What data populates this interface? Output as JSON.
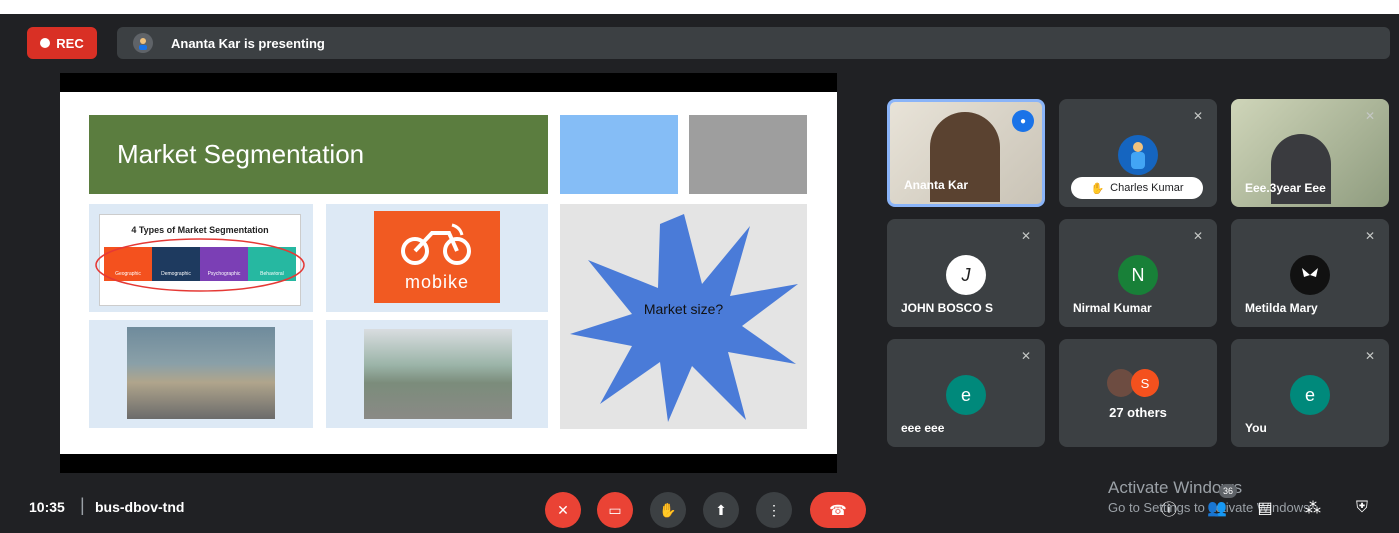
{
  "recording": {
    "label": "REC"
  },
  "presenter_bar": {
    "text": "Ananta Kar is presenting"
  },
  "slide": {
    "title": "Market Segmentation",
    "types_card": {
      "title": "4 Types of Market Segmentation",
      "segments": [
        "Geographic",
        "Demographic",
        "Psychographic",
        "Behavioral"
      ]
    },
    "logo_text": "mobike",
    "starburst_text": "Market size?"
  },
  "participants": [
    {
      "name": "Ananta Kar",
      "initial": "",
      "muted": false,
      "speaking": true,
      "hand_raised": false
    },
    {
      "name": "Charles Kumar",
      "initial": "",
      "muted": true,
      "speaking": false,
      "hand_raised": true
    },
    {
      "name": "Eee.3year Eee",
      "initial": "",
      "muted": true,
      "speaking": false,
      "hand_raised": false
    },
    {
      "name": "JOHN BOSCO S",
      "initial": "J",
      "muted": true
    },
    {
      "name": "Nirmal Kumar",
      "initial": "N",
      "muted": true
    },
    {
      "name": "Metilda Mary",
      "initial": "",
      "muted": true
    },
    {
      "name": "eee eee",
      "initial": "e",
      "muted": true
    },
    {
      "name": "27 others",
      "initial": "S",
      "muted": false
    },
    {
      "name": "You",
      "initial": "e",
      "muted": true
    }
  ],
  "bottom_bar": {
    "time": "10:35",
    "separator": "|",
    "meeting_code": "bus-dbov-tnd",
    "participant_count": "36"
  },
  "watermark": {
    "line1": "Activate Windows",
    "line2": "Go to Settings to activate Windows."
  },
  "colors": {
    "background": "#202124",
    "tile": "#3c4043",
    "red": "#ea4335",
    "accent_blue": "#1a73e8"
  }
}
